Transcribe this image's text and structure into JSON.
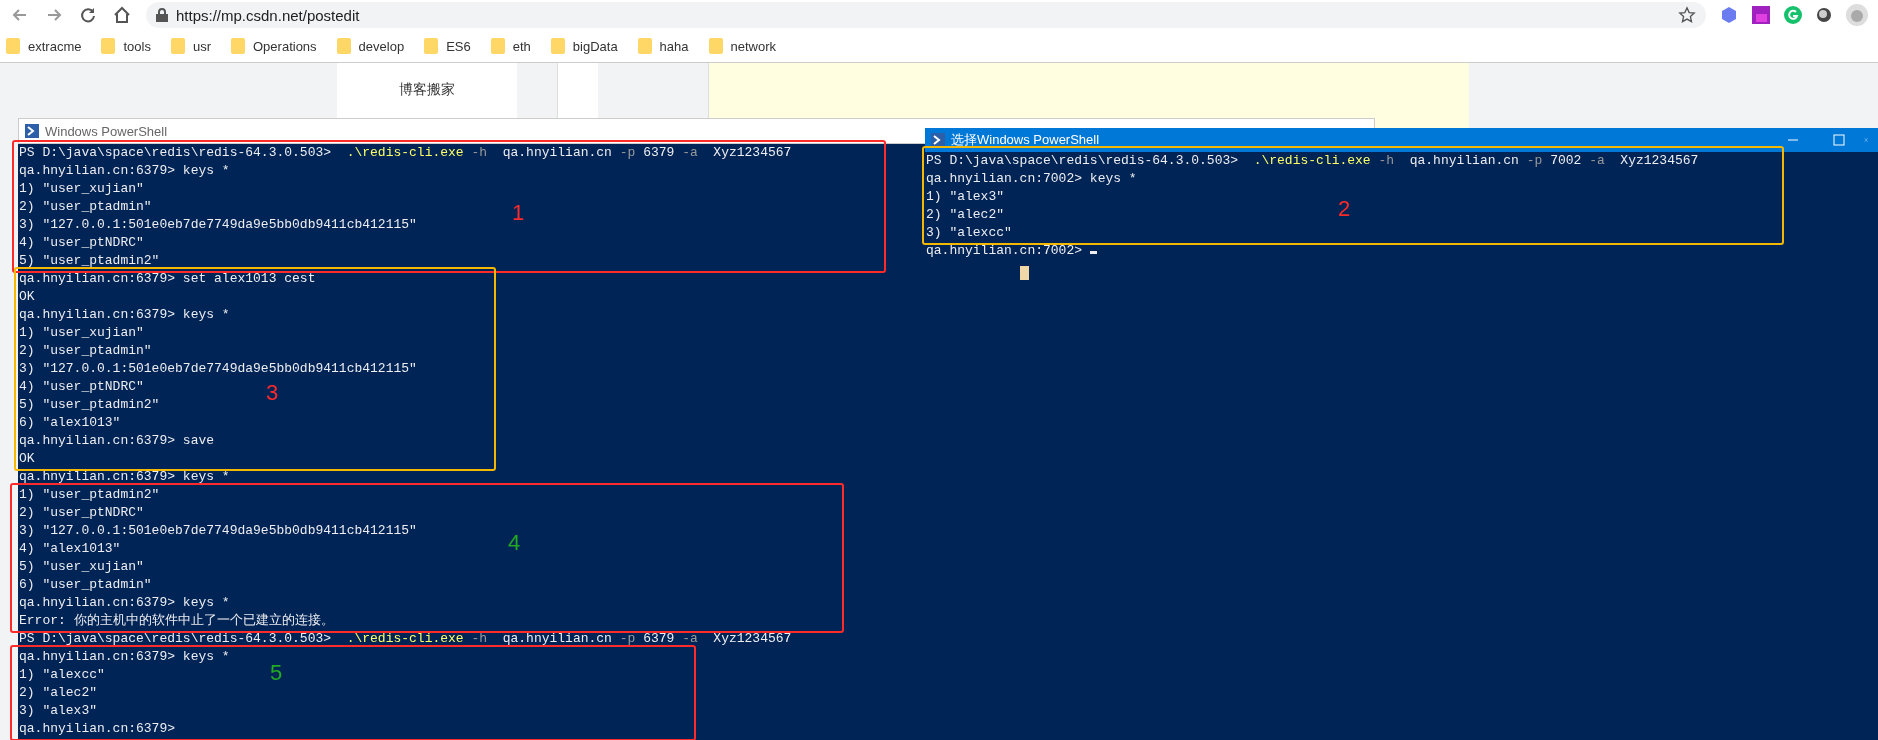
{
  "browser": {
    "url": "https://mp.csdn.net/postedit",
    "bookmarks": [
      "extracme",
      "tools",
      "usr",
      "Operations",
      "develop",
      "ES6",
      "eth",
      "bigData",
      "haha",
      "network"
    ]
  },
  "page": {
    "sidebar_item": "博客搬家"
  },
  "windows": [
    {
      "title": "Windows PowerShell",
      "active": false,
      "lines": [
        {
          "segments": [
            {
              "kind": "plain",
              "text": "PS D:\\java\\space\\redis\\redis-64.3.0.503>  "
            },
            {
              "kind": "command",
              "text": ".\\redis-cli.exe"
            },
            {
              "kind": "flag",
              "text": " -h"
            },
            {
              "kind": "plain",
              "text": "  qa.hnyilian.cn "
            },
            {
              "kind": "flag",
              "text": "-p"
            },
            {
              "kind": "plain",
              "text": " 6379 "
            },
            {
              "kind": "flag",
              "text": "-a"
            },
            {
              "kind": "plain",
              "text": "  Xyz1234567"
            }
          ]
        },
        {
          "text": "qa.hnyilian.cn:6379> keys *"
        },
        {
          "text": "1) \"user_xujian\""
        },
        {
          "text": "2) \"user_ptadmin\""
        },
        {
          "text": "3) \"127.0.0.1:501e0eb7de7749da9e5bb0db9411cb412115\""
        },
        {
          "text": "4) \"user_ptNDRC\""
        },
        {
          "text": "5) \"user_ptadmin2\""
        },
        {
          "text": "qa.hnyilian.cn:6379> set alex1013 cest"
        },
        {
          "text": "OK"
        },
        {
          "text": "qa.hnyilian.cn:6379> keys *"
        },
        {
          "text": "1) \"user_xujian\""
        },
        {
          "text": "2) \"user_ptadmin\""
        },
        {
          "text": "3) \"127.0.0.1:501e0eb7de7749da9e5bb0db9411cb412115\""
        },
        {
          "text": "4) \"user_ptNDRC\""
        },
        {
          "text": "5) \"user_ptadmin2\""
        },
        {
          "text": "6) \"alex1013\""
        },
        {
          "text": "qa.hnyilian.cn:6379> save"
        },
        {
          "text": "OK"
        },
        {
          "text": "qa.hnyilian.cn:6379> keys *"
        },
        {
          "text": "1) \"user_ptadmin2\""
        },
        {
          "text": "2) \"user_ptNDRC\""
        },
        {
          "text": "3) \"127.0.0.1:501e0eb7de7749da9e5bb0db9411cb412115\""
        },
        {
          "text": "4) \"alex1013\""
        },
        {
          "text": "5) \"user_xujian\""
        },
        {
          "text": "6) \"user_ptadmin\""
        },
        {
          "text": "qa.hnyilian.cn:6379> keys *"
        },
        {
          "text": "Error: 你的主机中的软件中止了一个已建立的连接。"
        },
        {
          "segments": [
            {
              "kind": "plain",
              "text": "PS D:\\java\\space\\redis\\redis-64.3.0.503>  "
            },
            {
              "kind": "command",
              "text": ".\\redis-cli.exe"
            },
            {
              "kind": "flag",
              "text": " -h"
            },
            {
              "kind": "plain",
              "text": "  qa.hnyilian.cn "
            },
            {
              "kind": "flag",
              "text": "-p"
            },
            {
              "kind": "plain",
              "text": " 6379 "
            },
            {
              "kind": "flag",
              "text": "-a"
            },
            {
              "kind": "plain",
              "text": "  Xyz1234567"
            }
          ]
        },
        {
          "text": "qa.hnyilian.cn:6379> keys *"
        },
        {
          "text": "1) \"alexcc\""
        },
        {
          "text": "2) \"alec2\""
        },
        {
          "text": "3) \"alex3\""
        },
        {
          "text": "qa.hnyilian.cn:6379>"
        }
      ]
    },
    {
      "title": "选择Windows PowerShell",
      "active": true,
      "lines": [
        {
          "segments": [
            {
              "kind": "plain",
              "text": "PS D:\\java\\space\\redis\\redis-64.3.0.503>  "
            },
            {
              "kind": "command",
              "text": ".\\redis-cli.exe"
            },
            {
              "kind": "flag",
              "text": " -h"
            },
            {
              "kind": "plain",
              "text": "  qa.hnyilian.cn "
            },
            {
              "kind": "flag",
              "text": "-p"
            },
            {
              "kind": "plain",
              "text": " 7002 "
            },
            {
              "kind": "flag",
              "text": "-a"
            },
            {
              "kind": "plain",
              "text": "  Xyz1234567"
            }
          ]
        },
        {
          "text": "qa.hnyilian.cn:7002> keys *"
        },
        {
          "text": "1) \"alex3\""
        },
        {
          "text": "2) \"alec2\""
        },
        {
          "text": "3) \"alexcc\""
        },
        {
          "text": "qa.hnyilian.cn:7002> ",
          "cursor": true
        }
      ]
    }
  ],
  "annotations": [
    {
      "color": "#ff2a2a",
      "number": {
        "text": "1",
        "color": "#ff2a2a"
      }
    },
    {
      "color": "#f5b800",
      "number": {
        "text": "2",
        "color": "#ff2a2a"
      }
    },
    {
      "color": "#f5b800",
      "number": {
        "text": "3",
        "color": "#ff2a2a"
      }
    },
    {
      "color": "#ff2a2a",
      "number": {
        "text": "4",
        "color": "#22aa22"
      }
    },
    {
      "color": "#ff2a2a",
      "number": {
        "text": "5",
        "color": "#22aa22"
      }
    }
  ]
}
